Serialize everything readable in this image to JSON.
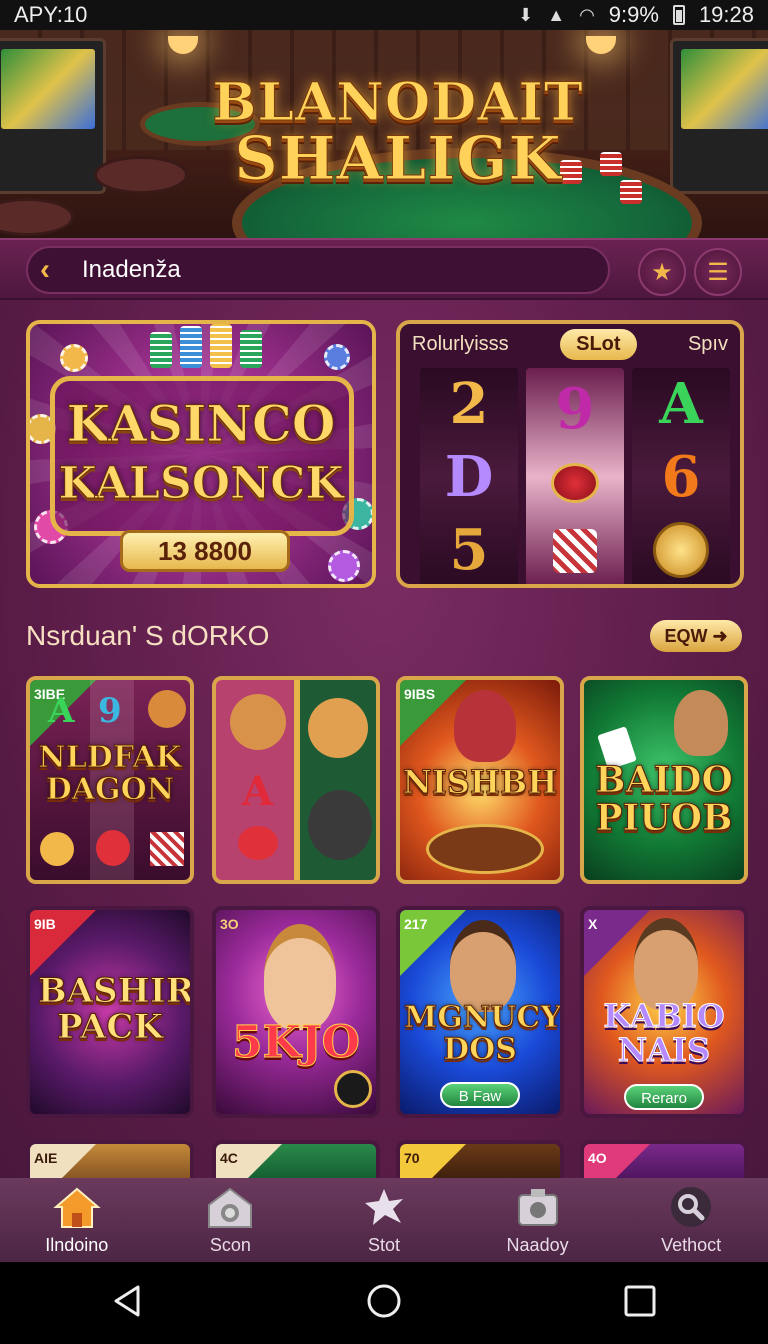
{
  "status_bar": {
    "left_text": "APY:10",
    "signal_text": "9:9%",
    "time": "19:28"
  },
  "hero": {
    "logo_line1": "BLANODAIT",
    "logo_line2": "SHALIGK"
  },
  "navbar": {
    "title": "Inadenža",
    "back_icon": "chevron-left-icon",
    "favorite_icon": "star-icon",
    "menu_icon": "hamburger-menu-icon",
    "accent_color": "#f3b84a"
  },
  "feature": {
    "title_line1": "KASINCO",
    "title_line2": "KALSONCK",
    "amount": "13 8800"
  },
  "slot_panel": {
    "tabs": [
      "Rolurlyisss",
      "SLot",
      "Spıv"
    ],
    "active_tab": 1,
    "reels": [
      [
        "2",
        "D",
        "5"
      ],
      [
        "9",
        "rose",
        "chips"
      ],
      [
        "A",
        "6",
        "coin"
      ]
    ]
  },
  "section": {
    "title": "Nsrduan' S dORKO",
    "more_label": "EQW"
  },
  "games_row1": [
    {
      "title": "NLDFAK DAGON",
      "badge": "3IBE",
      "reel_symbols": [
        "A",
        "9"
      ]
    },
    {
      "title": "",
      "badge": "",
      "reel_symbols": [
        "A"
      ]
    },
    {
      "title": "NISHBH",
      "badge": "9IBS",
      "reel_symbols": []
    },
    {
      "title": "BAIDO PIUOB",
      "badge": "",
      "reel_symbols": []
    }
  ],
  "games_row2": [
    {
      "title": "BASHIRS PACK",
      "badge": "9IB",
      "button": ""
    },
    {
      "title": "5KJO",
      "badge": "3O",
      "button": ""
    },
    {
      "title": "MGNUCY DOS",
      "badge": "217",
      "button": "B Faw"
    },
    {
      "title": "KABIO NAIS",
      "badge": "X",
      "button": "Reraro"
    }
  ],
  "games_row3_badges": [
    "AIE",
    "4C",
    "70",
    "4O"
  ],
  "bottom_nav": [
    {
      "label": "Ilndoino",
      "icon": "home-icon",
      "active": true
    },
    {
      "label": "Scon",
      "icon": "camera-icon",
      "active": false
    },
    {
      "label": "Stot",
      "icon": "star-burst-icon",
      "active": false
    },
    {
      "label": "Naadoy",
      "icon": "photo-icon",
      "active": false
    },
    {
      "label": "Vethoct",
      "icon": "search-icon",
      "active": false
    }
  ],
  "system_nav": [
    "back-icon",
    "home-circle-icon",
    "recents-icon"
  ]
}
